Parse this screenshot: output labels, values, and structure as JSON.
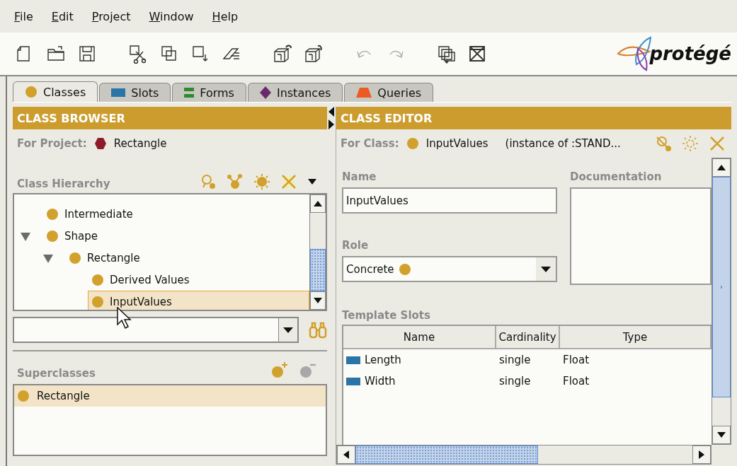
{
  "menu": [
    "File",
    "Edit",
    "Project",
    "Window",
    "Help"
  ],
  "toolbar": [
    {
      "kind": "new",
      "disabled": false
    },
    {
      "kind": "open",
      "disabled": false
    },
    {
      "kind": "save",
      "disabled": false
    },
    {
      "kind": "cut",
      "disabled": false
    },
    {
      "kind": "copy",
      "disabled": false
    },
    {
      "kind": "paste",
      "disabled": false
    },
    {
      "kind": "erase",
      "disabled": false
    },
    {
      "kind": "undo-box",
      "disabled": false
    },
    {
      "kind": "redo-box",
      "disabled": false
    },
    {
      "kind": "undo",
      "disabled": true
    },
    {
      "kind": "redo",
      "disabled": true
    },
    {
      "kind": "windows",
      "disabled": false
    },
    {
      "kind": "close-windows",
      "disabled": false
    }
  ],
  "logo": "protégé",
  "tabs": [
    {
      "label": "Classes",
      "kind": "class",
      "selected": true
    },
    {
      "label": "Slots",
      "kind": "slot",
      "selected": false
    },
    {
      "label": "Forms",
      "kind": "form",
      "selected": false
    },
    {
      "label": "Instances",
      "kind": "instance",
      "selected": false
    },
    {
      "label": "Queries",
      "kind": "query",
      "selected": false
    }
  ],
  "class_browser": {
    "title": "CLASS BROWSER",
    "project_label": "For Project:",
    "project": "Rectangle",
    "hierarchy_label": "Class Hierarchy",
    "tree": [
      {
        "label": "Intermediate",
        "selected": false
      },
      {
        "label": "Shape",
        "expanded": true,
        "selected": false,
        "children": [
          {
            "label": "Rectangle",
            "expanded": true,
            "selected": false,
            "children": [
              {
                "label": "Derived Values",
                "selected": false
              },
              {
                "label": "InputValues",
                "selected": true
              }
            ]
          }
        ]
      }
    ],
    "superclasses_label": "Superclasses",
    "superclasses": [
      {
        "label": "Rectangle",
        "selected": true
      }
    ]
  },
  "class_editor": {
    "title": "CLASS EDITOR",
    "class_label": "For Class:",
    "class_name": "InputValues",
    "instance_of": "(instance of :STAND...",
    "name_label": "Name",
    "name_value": "InputValues",
    "documentation_label": "Documentation",
    "role_label": "Role",
    "role_value": "Concrete",
    "slots_label": "Template Slots",
    "slots_columns": [
      "Name",
      "Cardinality",
      "Type"
    ],
    "slots": [
      {
        "name": "Length",
        "cardinality": "single",
        "type": "Float"
      },
      {
        "name": "Width",
        "cardinality": "single",
        "type": "Float"
      }
    ]
  }
}
